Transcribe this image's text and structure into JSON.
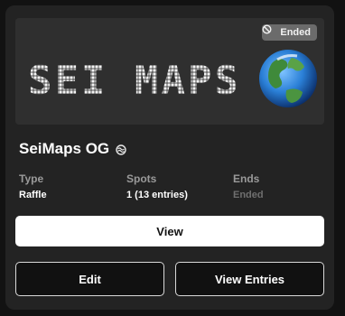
{
  "banner": {
    "logo_text": "SEI MAPS",
    "badge_label": "Ended",
    "badge_icon": "ban-icon"
  },
  "title": "SeiMaps OG",
  "title_icon": "sei-logo-icon",
  "meta": {
    "type_label": "Type",
    "type_value": "Raffle",
    "spots_label": "Spots",
    "spots_value": "1 (13 entries)",
    "ends_label": "Ends",
    "ends_value": "Ended"
  },
  "buttons": {
    "view": "View",
    "edit": "Edit",
    "view_entries": "View Entries"
  },
  "colors": {
    "card_bg": "#232323",
    "page_bg": "#121212",
    "badge_bg": "#6b6b6b",
    "muted_text": "#9a9a9a"
  }
}
